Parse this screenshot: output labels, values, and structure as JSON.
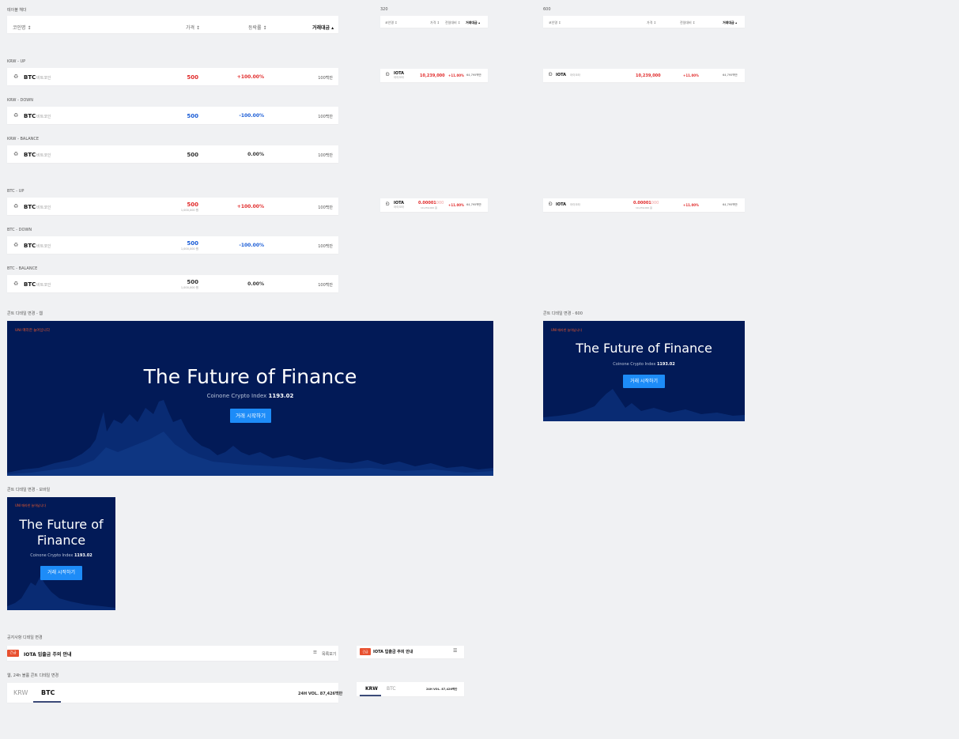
{
  "captions": {
    "table_header": "테이블 헤더",
    "w320": "320",
    "w600": "600",
    "krw_up": "KRW - UP",
    "krw_down": "KRW - DOWN",
    "krw_balance": "KRW - BALANCE",
    "btc_up": "BTC - UP",
    "btc_down": "BTC - DOWN",
    "btc_balance": "BTC - BALANCE",
    "banner_web": "콘트 디테일 변경 - 웹",
    "banner_600": "콘트 디테일 변경 - 600",
    "banner_mobile": "콘트 디테일 변경 - 모바일",
    "notice": "공지사항 디테일 변경",
    "tabs_web": "웹, 24h 볼륨 콘트 디테일 변경"
  },
  "table_header": {
    "coin": "코인명 ↕",
    "price": "가격 ↕",
    "change": "등락률 ↕",
    "volume": "거래대금 ▴"
  },
  "small_header": {
    "coin": "코인명 ↕",
    "price": "가격 ↕",
    "change": "전일대비 ↕",
    "volume": "거래대금 ▴"
  },
  "rows": {
    "icon": "♻",
    "symbol": "BTC",
    "name": "비트코인",
    "price": "500",
    "sub_price": "1,000,000 원",
    "up_change": "+100.00%",
    "down_change": "-100.00%",
    "flat_change": "0.00%",
    "volume": "100백만"
  },
  "iota": {
    "icon": "Ð",
    "symbol": "IOTA",
    "name": "아이오타",
    "krw_price": "10,239,000",
    "btc_price": "0.00001",
    "btc_price_tail": "000",
    "btc_sub": "10,239,000 원",
    "change": "+11.00%",
    "volume": "64,795백만"
  },
  "banner": {
    "uni": "UNI 매라한 늘어납니다",
    "title": "The Future of Finance",
    "title_line1": "The Future of",
    "title_line2": "Finance",
    "index_label": "Coinone Crypto Index",
    "index_value": "1193.02",
    "button": "거래 시작하기"
  },
  "notice": {
    "badge": "긴급",
    "title": "IOTA 입출금 주의 안내",
    "list_label": "목록보기",
    "list_icon": "☰"
  },
  "tabs": {
    "krw": "KRW",
    "btc": "BTC",
    "vol": "24H VOL. 87,426백만"
  },
  "colors": {
    "page_bg": "#f0f1f3",
    "banner_bg": "#021a57",
    "up": "#e12b2b",
    "down": "#1a5cd6",
    "button": "#1d8cf8",
    "badge": "#e8502f"
  }
}
